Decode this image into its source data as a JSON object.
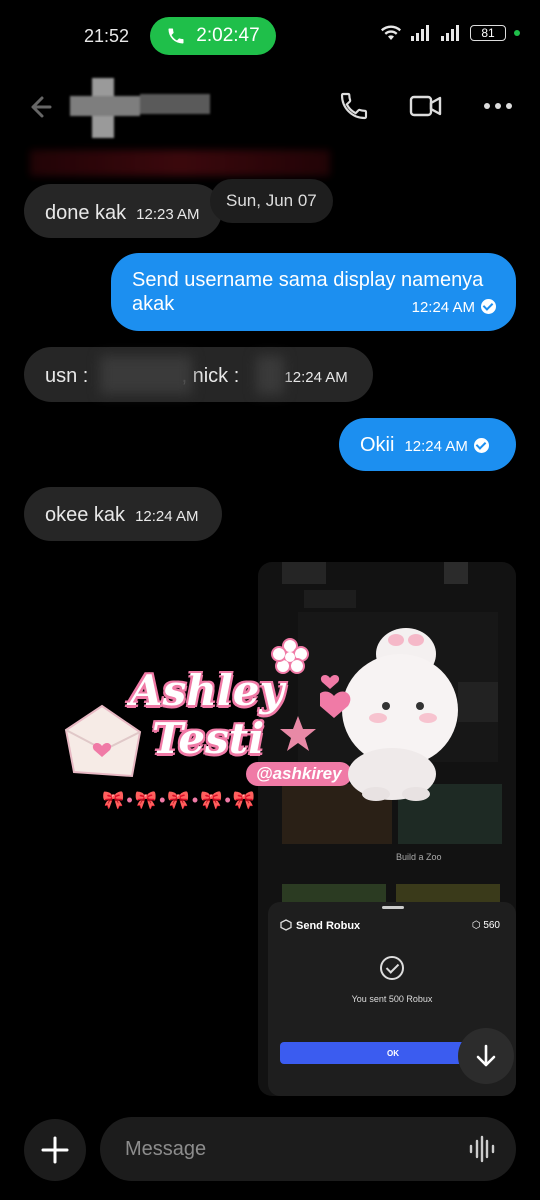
{
  "status_bar": {
    "time": "21:52",
    "call_duration": "2:02:47",
    "battery": "81"
  },
  "header": {
    "back_icon": "arrow-left-icon",
    "call_icon": "phone-icon",
    "video_icon": "video-icon",
    "more_icon": "more-dots-icon"
  },
  "date_separator": "Sun, Jun 07",
  "messages": [
    {
      "direction": "received",
      "text": "done kak",
      "time": "12:23 AM"
    },
    {
      "direction": "sent",
      "text_line1": "Send username sama display namenya",
      "text_line2": "akak",
      "time": "12:24 AM"
    },
    {
      "direction": "received",
      "text_a": "usn :",
      "text_b": ", nick :",
      "time": "12:24 AM"
    },
    {
      "direction": "sent",
      "text": "Okii",
      "time": "12:24 AM"
    },
    {
      "direction": "received",
      "text": "okee kak",
      "time": "12:24 AM"
    }
  ],
  "image_message": {
    "sticker_line1": "Ashley",
    "sticker_line2": "Testi",
    "sticker_handle": "@ashkirey",
    "game_caption": "Build a Zoo",
    "robux_title": "Send Robux",
    "robux_balance": "560",
    "robux_message": "You sent 500 Robux",
    "ok_label": "OK"
  },
  "composer": {
    "placeholder": "Message",
    "plus_icon": "plus-icon",
    "voice_icon": "waveform-icon"
  },
  "colors": {
    "sent_bubble": "#1c8ff0",
    "received_bubble": "#262626",
    "call_pill": "#1fbf4a"
  }
}
